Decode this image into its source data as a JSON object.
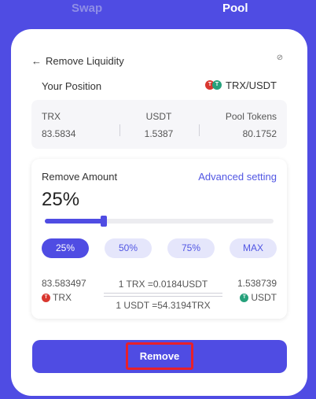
{
  "tabs": {
    "swap": "Swap",
    "pool": "Pool"
  },
  "header": {
    "back_icon": "arrow-left-icon",
    "title": "Remove Liquidity",
    "settings_icon": "settings-icon"
  },
  "position": {
    "label": "Your Position",
    "pair": "TRX/USDT",
    "columns": [
      {
        "label": "TRX",
        "value": "83.5834"
      },
      {
        "label": "USDT",
        "value": "1.5387"
      },
      {
        "label": "Pool Tokens",
        "value": "80.1752"
      }
    ]
  },
  "remove_amount": {
    "label": "Remove Amount",
    "advanced": "Advanced setting",
    "percent_display": "25%",
    "slider_fraction": 0.25,
    "options": [
      "25%",
      "50%",
      "75%",
      "MAX"
    ],
    "selected_option": "25%"
  },
  "receive": {
    "trx_amount": "83.583497",
    "trx_token": "TRX",
    "usdt_amount": "1.538739",
    "usdt_token": "USDT",
    "rate1": "1 TRX =0.0184USDT",
    "rate2": "1 USDT =54.3194TRX"
  },
  "action": {
    "remove_label": "Remove",
    "highlight_color": "#e8202a"
  },
  "colors": {
    "accent": "#4f4ce3",
    "trx": "#d9372f",
    "usdt": "#26a17b"
  }
}
